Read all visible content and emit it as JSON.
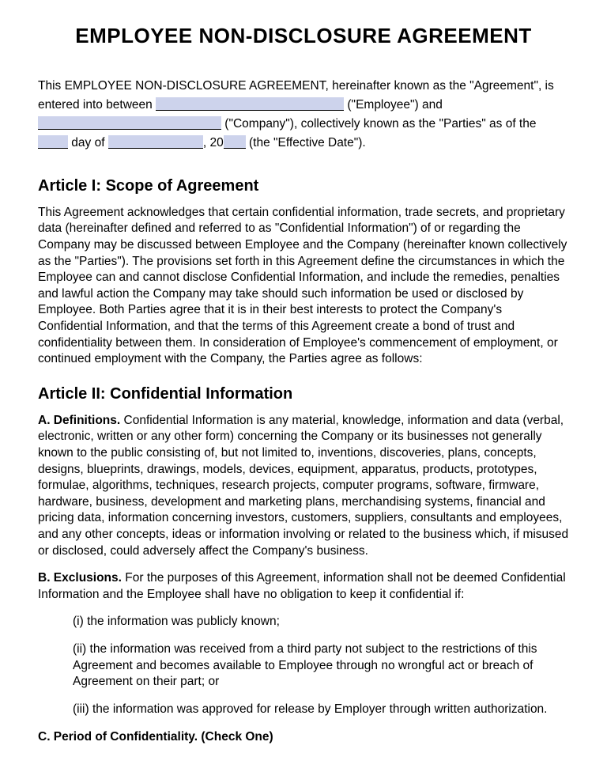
{
  "title": "EMPLOYEE NON-DISCLOSURE AGREEMENT",
  "intro": {
    "part1": "This EMPLOYEE NON-DISCLOSURE AGREEMENT, hereinafter known as the \"Agreement\", is entered into between ",
    "part2": " (\"Employee\") and ",
    "part3": " (\"Company\"), collectively known as the \"Parties\" as of the ",
    "part4": " day of ",
    "part5": ", 20",
    "part6": " (the \"Effective Date\")."
  },
  "article1": {
    "heading": "Article I: Scope of Agreement",
    "body": "This Agreement acknowledges that certain confidential information, trade secrets, and proprietary data (hereinafter defined and referred to as \"Confidential Information\") of or regarding the Company may be discussed between Employee and the Company (hereinafter known collectively as the \"Parties\"). The provisions set forth in this Agreement define the circumstances in which the Employee can and cannot disclose Confidential Information, and include the remedies, penalties and lawful action the Company may take should such information be used or disclosed by Employee. Both Parties agree that it is in their best interests to protect the Company's Confidential Information, and that the terms of this Agreement create a bond of trust and confidentiality between them. In consideration of Employee's commencement of employment, or continued employment with the Company, the Parties agree as follows:"
  },
  "article2": {
    "heading": "Article II: Confidential Information",
    "a_label": "A. Definitions.",
    "a_body": " Confidential Information is any material, knowledge, information and data (verbal, electronic, written or any other form) concerning the Company or its businesses not generally known to the public consisting of, but not limited to, inventions, discoveries, plans, concepts, designs, blueprints, drawings, models, devices, equipment, apparatus, products, prototypes, formulae, algorithms, techniques, research projects, computer programs, software, firmware, hardware, business, development and marketing plans, merchandising systems, financial and pricing data, information concerning investors, customers, suppliers, consultants and employees, and any other concepts, ideas or information involving or related to the business which, if misused or disclosed, could adversely affect the Company's business.",
    "b_label": "B. Exclusions.",
    "b_body": " For the purposes of this Agreement, information shall not be deemed Confidential Information and the Employee shall have no obligation to keep it confidential if:",
    "b_i": "(i) the information was publicly known;",
    "b_ii": "(ii) the information was received from a third party not subject to the restrictions of this Agreement and becomes available to Employee through no wrongful act or breach of Agreement on their part; or",
    "b_iii": "(iii) the information was approved for release by Employer through written authorization.",
    "c_label": "C. Period of Confidentiality. (Check One)"
  }
}
